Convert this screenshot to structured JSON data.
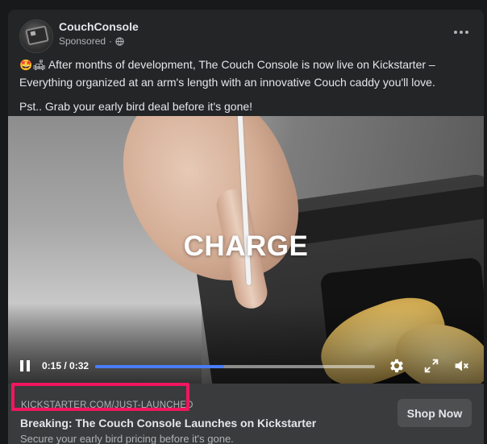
{
  "post": {
    "page_name": "CouchConsole",
    "sponsored_label": "Sponsored",
    "dot_separator": "·",
    "text_line1_emoji": "🤩🛋",
    "text_line1": "After months of development, The Couch Console is now live on Kickstarter – Everything organized at an arm's length with an innovative Couch caddy you'll love.",
    "text_line2": "Pst.. Grab your early bird deal before it's gone!"
  },
  "video": {
    "caption": "CHARGE",
    "current_time": "0:15",
    "duration": "0:32",
    "time_display": "0:15 / 0:32",
    "progress": 0.46,
    "accent_color": "#4a7cf7"
  },
  "cta": {
    "domain": "KICKSTARTER.COM/JUST-LAUNCHED",
    "title": "Breaking: The Couch Console Launches on Kickstarter",
    "description": "Secure your early bird pricing before it's gone.",
    "button_label": "Shop Now"
  },
  "annotation": {
    "highlight_color": "#f2165f"
  },
  "icons": [
    "globe-icon",
    "more-options-icon",
    "pause-icon",
    "settings-icon",
    "fullscreen-icon",
    "volume-muted-icon"
  ]
}
